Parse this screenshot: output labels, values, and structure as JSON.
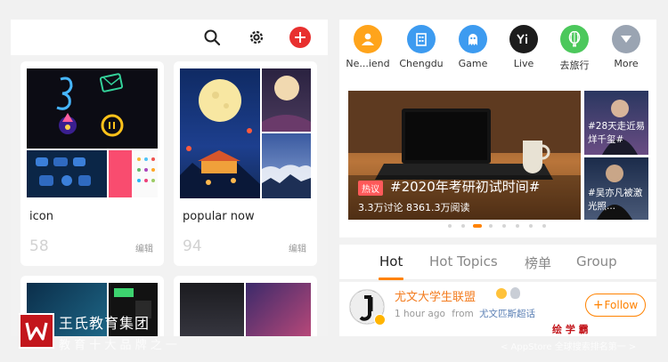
{
  "left": {
    "cards": [
      {
        "title": "icon",
        "count": "58",
        "edit": "编辑"
      },
      {
        "title": "popular now",
        "count": "94",
        "edit": "编辑"
      }
    ]
  },
  "right": {
    "shortcuts": [
      {
        "label": "Ne...iend",
        "icon": "user-icon",
        "color": "#ffa41b"
      },
      {
        "label": "Chengdu",
        "icon": "building-icon",
        "color": "#3d9bf0"
      },
      {
        "label": "Game",
        "icon": "ghost-icon",
        "color": "#3d9bf0"
      },
      {
        "label": "Live",
        "icon": "live-icon",
        "color": "#1c1c1c"
      },
      {
        "label": "去旅行",
        "icon": "balloon-icon",
        "color": "#4cc85c"
      },
      {
        "label": "More",
        "icon": "chevron-down-icon",
        "color": "#9aa4b2"
      }
    ],
    "banner": {
      "tag": "热议",
      "title": "#2020年考研初试时间#",
      "stats": "3.3万讨论  8361.3万阅读",
      "side1": "#28天走近易烊千玺#",
      "side2": "#吴亦凡被激光照..."
    },
    "tabs": [
      "Hot",
      "Hot Topics",
      "榜单",
      "Group"
    ],
    "feed": {
      "name": "尤文大学生联盟",
      "time": "1 hour ago",
      "from_label": "from",
      "source": "尤文匹斯超话",
      "follow_label": "Follow"
    }
  },
  "watermark": {
    "org": "王氏教育集团",
    "chars": "教 育 十 大 品 牌 之 一",
    "mark": "绘 学 霸",
    "appstore": "< AppStore 全球搜索排名第一 >"
  },
  "colors": {
    "brand_orange": "#ff8200",
    "add_red": "#e8302f",
    "watermark_red": "#c3161c"
  }
}
